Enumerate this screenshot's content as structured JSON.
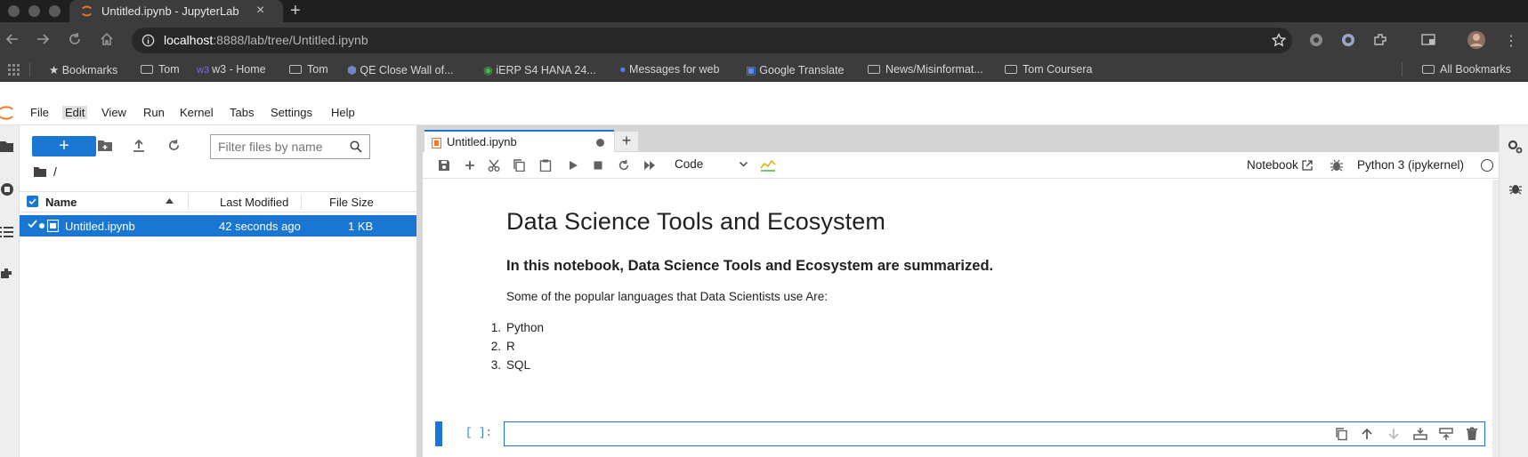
{
  "browser": {
    "tab_title": "Untitled.ipynb - JupyterLab",
    "url_host": "localhost",
    "url_rest": ":8888/lab/tree/Untitled.ipynb",
    "bookmarks": [
      "Bookmarks",
      "Tom",
      "w3 - Home",
      "Tom",
      "QE Close Wall of...",
      "iERP S4 HANA 24...",
      "Messages for web",
      "Google Translate",
      "News/Misinformat...",
      "Tom Coursera"
    ],
    "all_bookmarks": "All Bookmarks"
  },
  "menu": {
    "items": [
      "File",
      "Edit",
      "View",
      "Run",
      "Kernel",
      "Tabs",
      "Settings",
      "Help"
    ],
    "active": "Edit"
  },
  "filebrowser": {
    "new_label": "+",
    "filter_placeholder": "Filter files by name",
    "breadcrumb": "/",
    "columns": {
      "name": "Name",
      "modified": "Last Modified",
      "size": "File Size"
    },
    "rows": [
      {
        "name": "Untitled.ipynb",
        "modified": "42 seconds ago",
        "size": "1 KB",
        "selected": true
      }
    ]
  },
  "notebook": {
    "tab_title": "Untitled.ipynb",
    "cell_type": "Code",
    "notebook_label": "Notebook",
    "kernel_label": "Python 3 (ipykernel)",
    "markdown": {
      "heading": "Data Science Tools and Ecosystem",
      "subheading": "In this notebook, Data Science Tools and Ecosystem are summarized.",
      "paragraph": "Some of the popular languages that Data Scientists use Are:",
      "list": [
        "Python",
        "R",
        "SQL"
      ]
    },
    "code_prompt": "[ ]:"
  },
  "colors": {
    "accent": "#1976d2",
    "browser_dark": "#3c3c3c",
    "jupyter_logo": "#f37726"
  }
}
